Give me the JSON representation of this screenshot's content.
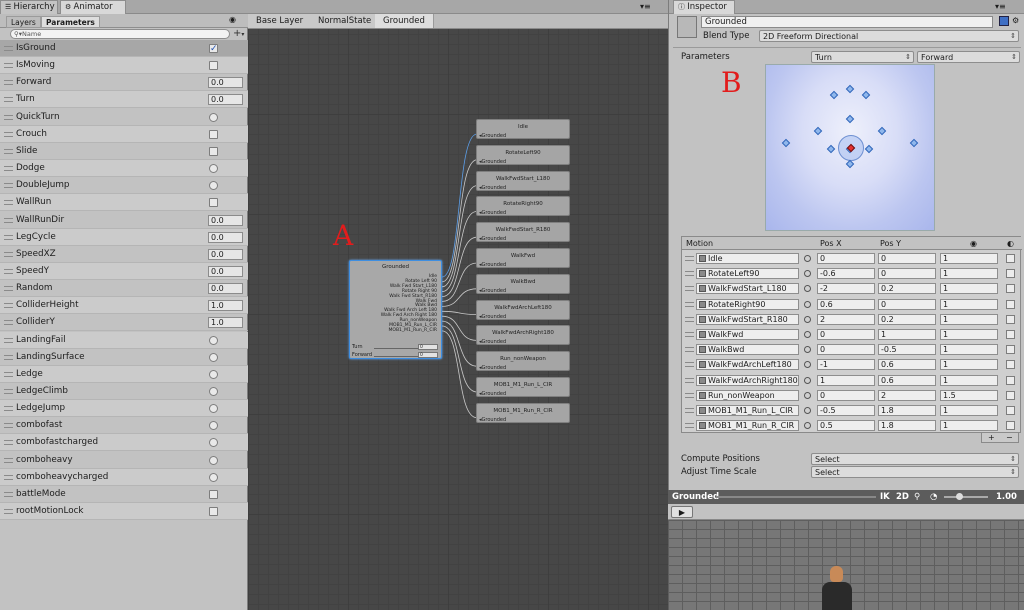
{
  "tabs": {
    "hierarchy": "Hierarchy",
    "animator": "Animator",
    "inspector": "Inspector"
  },
  "left": {
    "tab_layers": "Layers",
    "tab_parameters": "Parameters",
    "search_placeholder": "Name",
    "params": [
      {
        "name": "IsGround",
        "kind": "bool",
        "value": true
      },
      {
        "name": "IsMoving",
        "kind": "bool",
        "value": false
      },
      {
        "name": "Forward",
        "kind": "float",
        "value": "0.0"
      },
      {
        "name": "Turn",
        "kind": "float",
        "value": "0.0"
      },
      {
        "name": "QuickTurn",
        "kind": "trigger"
      },
      {
        "name": "Crouch",
        "kind": "bool",
        "value": false
      },
      {
        "name": "Slide",
        "kind": "bool",
        "value": false
      },
      {
        "name": "Dodge",
        "kind": "trigger"
      },
      {
        "name": "DoubleJump",
        "kind": "trigger"
      },
      {
        "name": "WallRun",
        "kind": "bool",
        "value": false
      },
      {
        "name": "WallRunDir",
        "kind": "float",
        "value": "0.0"
      },
      {
        "name": "LegCycle",
        "kind": "float",
        "value": "0.0"
      },
      {
        "name": "SpeedXZ",
        "kind": "float",
        "value": "0.0"
      },
      {
        "name": "SpeedY",
        "kind": "float",
        "value": "0.0"
      },
      {
        "name": "Random",
        "kind": "float",
        "value": "0.0"
      },
      {
        "name": "ColliderHeight",
        "kind": "float",
        "value": "1.0"
      },
      {
        "name": "ColliderY",
        "kind": "float",
        "value": "1.0"
      },
      {
        "name": "LandingFail",
        "kind": "trigger"
      },
      {
        "name": "LandingSurface",
        "kind": "trigger"
      },
      {
        "name": "Ledge",
        "kind": "trigger"
      },
      {
        "name": "LedgeClimb",
        "kind": "trigger"
      },
      {
        "name": "LedgeJump",
        "kind": "trigger"
      },
      {
        "name": "combofast",
        "kind": "trigger"
      },
      {
        "name": "combofastcharged",
        "kind": "trigger"
      },
      {
        "name": "comboheavy",
        "kind": "trigger"
      },
      {
        "name": "comboheavycharged",
        "kind": "trigger"
      },
      {
        "name": "battleMode",
        "kind": "bool",
        "value": false
      },
      {
        "name": "rootMotionLock",
        "kind": "bool",
        "value": false
      }
    ]
  },
  "graph": {
    "breadcrumbs": [
      "Base Layer",
      "NormalState",
      "Grounded"
    ],
    "label_a": "A",
    "blend_node": {
      "title": "Grounded",
      "motions": [
        "Idle",
        "Rotate Left 90",
        "Walk Fwd Start_L180",
        "Rotate Right 90",
        "Walk Fwd Start_R180",
        "Walk Fwd",
        "Walk Bwd",
        "Walk Fwd Arch Left 180",
        "Walk Fwd Arch Right 180",
        "Run_nonWeapon",
        "MOB1_M1_Run_L_CIR",
        "MOB1_M1_Run_R_CIR"
      ],
      "slider1_label": "Turn",
      "slider1_value": "0",
      "slider2_label": "Forward",
      "slider2_value": "0"
    },
    "motion_nodes": [
      {
        "title": "Idle",
        "sub": "Grounded"
      },
      {
        "title": "RotateLeft90",
        "sub": "Grounded"
      },
      {
        "title": "WalkFwdStart_L180",
        "sub": "Grounded"
      },
      {
        "title": "RotateRight90",
        "sub": "Grounded"
      },
      {
        "title": "WalkFwdStart_R180",
        "sub": "Grounded"
      },
      {
        "title": "WalkFwd",
        "sub": "Grounded"
      },
      {
        "title": "WalkBwd",
        "sub": "Grounded"
      },
      {
        "title": "WalkFwdArchLeft180",
        "sub": "Grounded"
      },
      {
        "title": "WalkFwdArchRight180",
        "sub": "Grounded"
      },
      {
        "title": "Run_nonWeapon",
        "sub": "Grounded"
      },
      {
        "title": "MOB1_M1_Run_L_CIR",
        "sub": "Grounded"
      },
      {
        "title": "MOB1_M1_Run_R_CIR",
        "sub": "Grounded"
      }
    ]
  },
  "inspector": {
    "name": "Grounded",
    "blend_type_label": "Blend Type",
    "blend_type_value": "2D Freeform Directional",
    "parameters_label": "Parameters",
    "param_x": "Turn",
    "param_y": "Forward",
    "label_b": "B",
    "headers": {
      "motion": "Motion",
      "posx": "Pos X",
      "posy": "Pos Y"
    },
    "motions": [
      {
        "name": "Idle",
        "x": "0",
        "y": "0",
        "speed": "1"
      },
      {
        "name": "RotateLeft90",
        "x": "-0.6",
        "y": "0",
        "speed": "1"
      },
      {
        "name": "WalkFwdStart_L180",
        "x": "-2",
        "y": "0.2",
        "speed": "1"
      },
      {
        "name": "RotateRight90",
        "x": "0.6",
        "y": "0",
        "speed": "1"
      },
      {
        "name": "WalkFwdStart_R180",
        "x": "2",
        "y": "0.2",
        "speed": "1"
      },
      {
        "name": "WalkFwd",
        "x": "0",
        "y": "1",
        "speed": "1"
      },
      {
        "name": "WalkBwd",
        "x": "0",
        "y": "-0.5",
        "speed": "1"
      },
      {
        "name": "WalkFwdArchLeft180",
        "x": "-1",
        "y": "0.6",
        "speed": "1"
      },
      {
        "name": "WalkFwdArchRight180",
        "x": "1",
        "y": "0.6",
        "speed": "1"
      },
      {
        "name": "Run_nonWeapon",
        "x": "0",
        "y": "2",
        "speed": "1.5"
      },
      {
        "name": "MOB1_M1_Run_L_CIR",
        "x": "-0.5",
        "y": "1.8",
        "speed": "1"
      },
      {
        "name": "MOB1_M1_Run_R_CIR",
        "x": "0.5",
        "y": "1.8",
        "speed": "1"
      }
    ],
    "compute_label": "Compute Positions",
    "compute_value": "Select",
    "adjust_label": "Adjust Time Scale",
    "adjust_value": "Select",
    "add_button": "+",
    "remove_button": "−"
  },
  "preview": {
    "title": "Grounded",
    "ik": "IK",
    "mode": "2D",
    "speed": "1.00"
  }
}
